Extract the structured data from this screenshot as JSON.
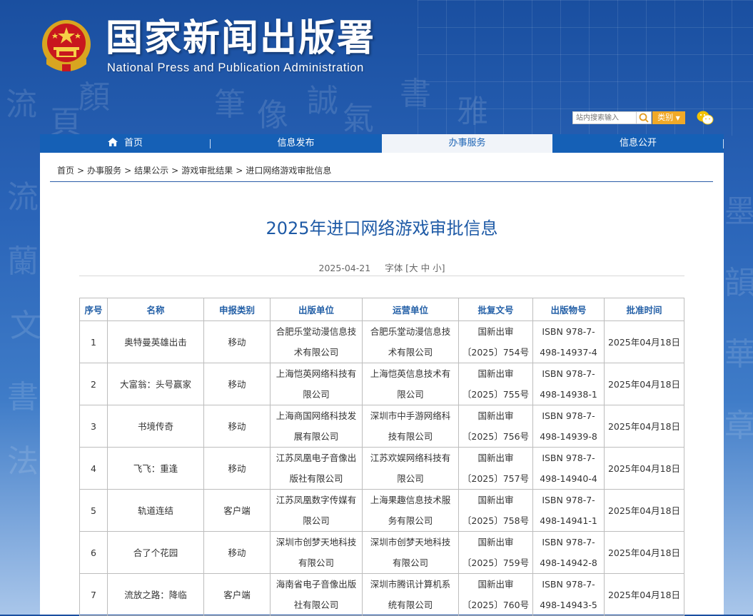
{
  "header": {
    "title_cn": "国家新闻出版署",
    "title_en": "National  Press and Publication Administration"
  },
  "search": {
    "placeholder": "站内搜索输入",
    "category_label": "类别"
  },
  "nav": {
    "items": [
      {
        "label": "首页",
        "icon": "home-icon"
      },
      {
        "label": "信息发布"
      },
      {
        "label": "办事服务",
        "active": true
      },
      {
        "label": "信息公开"
      }
    ]
  },
  "breadcrumb": [
    "首页",
    "办事服务",
    "结果公示",
    "游戏审批结果",
    "进口网络游戏审批信息"
  ],
  "article": {
    "title": "2025年进口网络游戏审批信息",
    "date": "2025-04-21",
    "font_label": "字体",
    "font_sizes": [
      "大",
      "中",
      "小"
    ]
  },
  "table": {
    "headers": [
      "序号",
      "名称",
      "申报类别",
      "出版单位",
      "运营单位",
      "批复文号",
      "出版物号",
      "批准时间"
    ],
    "rows": [
      {
        "no": "1",
        "name": "奥特曼英雄出击",
        "type": "移动",
        "publisher": [
          "合肥乐堂动漫信息技",
          "术有限公司"
        ],
        "operator": [
          "合肥乐堂动漫信息技",
          "术有限公司"
        ],
        "approval": [
          "国新出审",
          "〔2025〕754号"
        ],
        "isbn": [
          "ISBN 978-7-",
          "498-14937-4"
        ],
        "date": "2025年04月18日"
      },
      {
        "no": "2",
        "name": "大富翁：头号赢家",
        "type": "移动",
        "publisher": [
          "上海恺英网络科技有",
          "限公司"
        ],
        "operator": [
          "上海恺英信息技术有",
          "限公司"
        ],
        "approval": [
          "国新出审",
          "〔2025〕755号"
        ],
        "isbn": [
          "ISBN 978-7-",
          "498-14938-1"
        ],
        "date": "2025年04月18日"
      },
      {
        "no": "3",
        "name": "书境传奇",
        "type": "移动",
        "publisher": [
          "上海商国网络科技发",
          "展有限公司"
        ],
        "operator": [
          "深圳市中手游网络科",
          "技有限公司"
        ],
        "approval": [
          "国新出审",
          "〔2025〕756号"
        ],
        "isbn": [
          "ISBN 978-7-",
          "498-14939-8"
        ],
        "date": "2025年04月18日"
      },
      {
        "no": "4",
        "name": "飞飞：重逢",
        "type": "移动",
        "publisher": [
          "江苏凤凰电子音像出",
          "版社有限公司"
        ],
        "operator": [
          "江苏欢娱网络科技有",
          "限公司"
        ],
        "approval": [
          "国新出审",
          "〔2025〕757号"
        ],
        "isbn": [
          "ISBN 978-7-",
          "498-14940-4"
        ],
        "date": "2025年04月18日"
      },
      {
        "no": "5",
        "name": "轨道连结",
        "type": "客户端",
        "publisher": [
          "江苏凤凰数字传媒有",
          "限公司"
        ],
        "operator": [
          "上海果趣信息技术服",
          "务有限公司"
        ],
        "approval": [
          "国新出审",
          "〔2025〕758号"
        ],
        "isbn": [
          "ISBN 978-7-",
          "498-14941-1"
        ],
        "date": "2025年04月18日"
      },
      {
        "no": "6",
        "name": "合了个花园",
        "type": "移动",
        "publisher": [
          "深圳市创梦天地科技",
          "有限公司"
        ],
        "operator": [
          "深圳市创梦天地科技",
          "有限公司"
        ],
        "approval": [
          "国新出审",
          "〔2025〕759号"
        ],
        "isbn": [
          "ISBN 978-7-",
          "498-14942-8"
        ],
        "date": "2025年04月18日"
      },
      {
        "no": "7",
        "name": "流放之路：降临",
        "type": "客户端",
        "publisher": [
          "海南省电子音像出版",
          "社有限公司"
        ],
        "operator": [
          "深圳市腾讯计算机系",
          "统有限公司"
        ],
        "approval": [
          "国新出审",
          "〔2025〕760号"
        ],
        "isbn": [
          "ISBN 978-7-",
          "498-14943-5"
        ],
        "date": "2025年04月18日"
      }
    ]
  },
  "colors": {
    "nav_bg": "#1560b6",
    "accent": "#1e5aa6",
    "category_button": "#f0a928"
  }
}
